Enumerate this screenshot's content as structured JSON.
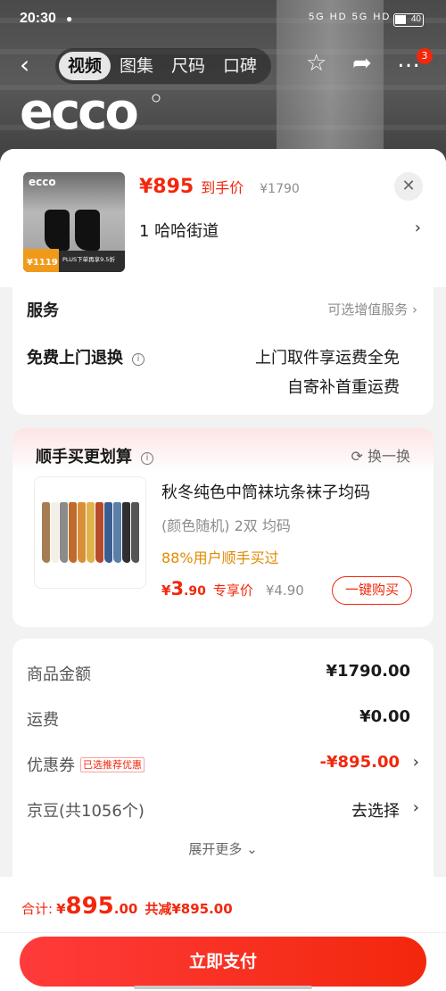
{
  "status_bar": {
    "time": "20:30",
    "signal": "5G HD 5G HD",
    "battery": "40"
  },
  "nav": {
    "back_icon": "chevron-left-icon",
    "tabs": [
      "视频",
      "图集",
      "尺码",
      "口碑"
    ],
    "active_tab": "视频",
    "favorite_icon": "star-icon",
    "share_icon": "share-icon",
    "more_icon": "more-icon",
    "badge": "3"
  },
  "brand": {
    "logo_text": "ecco"
  },
  "product": {
    "thumb_logo": "ecco",
    "thumb_promo_price": "¥1119",
    "thumb_promo_text": "PLUS下单再享9.5折",
    "price": "¥895",
    "price_label": "到手价",
    "original_price": "¥1790",
    "address": "1 哈哈街道"
  },
  "service": {
    "title": "服务",
    "optional": "可选增值服务",
    "return_title": "免费上门退换",
    "return_desc_1": "上门取件享运费全免",
    "return_desc_2": "自寄补首重运费"
  },
  "bundle": {
    "title": "顺手买更划算",
    "refresh_label": "换一换",
    "name": "秋冬纯色中筒袜坑条袜子均码",
    "spec": "(颜色随机) 2双   均码",
    "popularity": "88%用户顺手买过",
    "price_currency": "¥",
    "price_int": "3",
    "price_dec": ".90",
    "price_label": "专享价",
    "original_price": "¥4.90",
    "buy_label": "一键购买"
  },
  "summary": {
    "rows": [
      {
        "label": "商品金额",
        "value": "¥1790.00"
      },
      {
        "label": "运费",
        "value": "¥0.00"
      },
      {
        "label": "优惠券",
        "tag": "已选推荐优惠",
        "value": "-¥895.00"
      },
      {
        "label": "京豆(共1056个)",
        "value": "去选择"
      }
    ],
    "expand_label": "展开更多"
  },
  "total": {
    "label": "合计:",
    "currency": "¥",
    "amount_int": "895",
    "amount_dec": ".00",
    "saving": "共减¥895.00"
  },
  "pay_button": "立即支付",
  "colors": {
    "accent": "#f2270c",
    "orange": "#e08a00",
    "sheet_bg": "#f2f2f2"
  }
}
